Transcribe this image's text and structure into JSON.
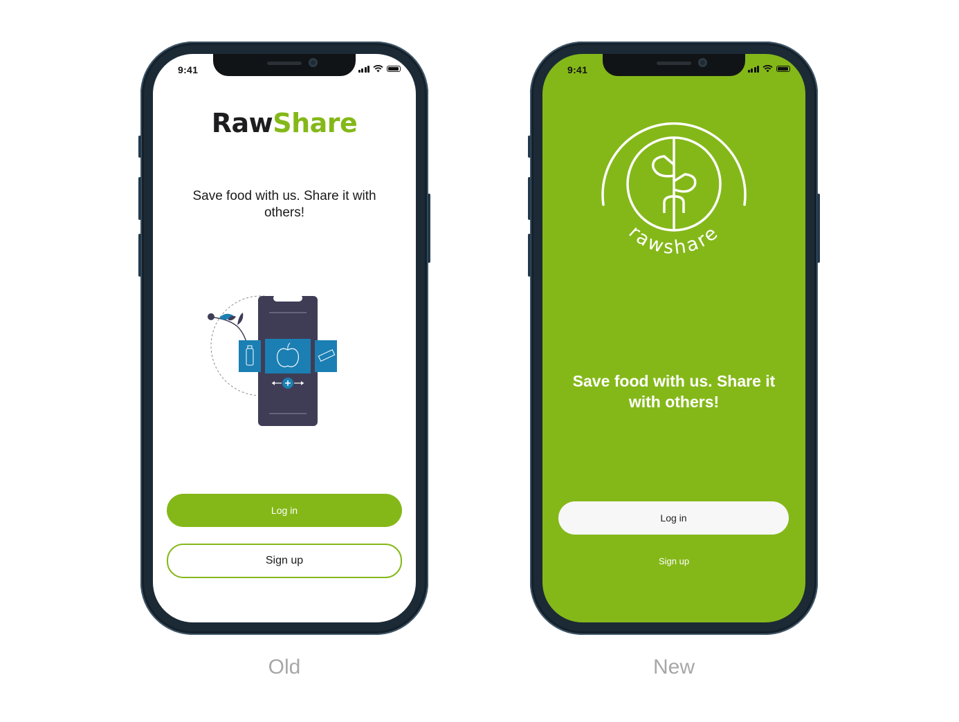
{
  "old": {
    "caption": "Old",
    "status_time": "9:41",
    "logo_raw": "Raw",
    "logo_share": "Share",
    "tagline": "Save food with us. Share it with others!",
    "login_label": "Log in",
    "signup_label": "Sign up",
    "colors": {
      "accent": "#84b819",
      "illustration_dark": "#3f3d56",
      "illustration_blue": "#1b7fb3"
    }
  },
  "new": {
    "caption": "New",
    "status_time": "9:41",
    "logo_text": "rawshare",
    "tagline": "Save food with us. Share it with others!",
    "login_label": "Log in",
    "signup_label": "Sign up",
    "colors": {
      "background": "#84b819",
      "button": "#f7f7f7"
    }
  }
}
